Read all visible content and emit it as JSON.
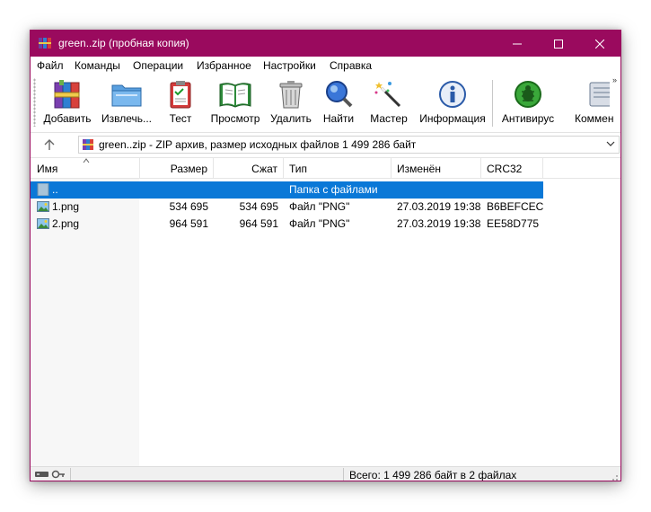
{
  "window": {
    "title": "green..zip (пробная копия)",
    "accent_color": "#9a0a5e"
  },
  "menu": [
    {
      "label": "Файл"
    },
    {
      "label": "Команды"
    },
    {
      "label": "Операции"
    },
    {
      "label": "Избранное"
    },
    {
      "label": "Настройки"
    },
    {
      "label": "Справка"
    }
  ],
  "toolbar": [
    {
      "label": "Добавить",
      "icon": "add-archive-icon"
    },
    {
      "label": "Извлечь...",
      "icon": "extract-folder-icon"
    },
    {
      "label": "Тест",
      "icon": "test-clipboard-icon"
    },
    {
      "label": "Просмотр",
      "icon": "view-book-icon"
    },
    {
      "label": "Удалить",
      "icon": "trash-icon"
    },
    {
      "label": "Найти",
      "icon": "magnifier-icon"
    },
    {
      "label": "Мастер",
      "icon": "wizard-wand-icon"
    },
    {
      "label": "Информация",
      "icon": "info-icon"
    },
    {
      "label": "Антивирус",
      "icon": "antivirus-bug-icon"
    },
    {
      "label": "Коммен",
      "icon": "comment-icon"
    }
  ],
  "address": {
    "path": "green..zip - ZIP архив, размер исходных файлов 1 499 286 байт"
  },
  "columns": [
    "Имя",
    "Размер",
    "Сжат",
    "Тип",
    "Изменён",
    "CRC32"
  ],
  "rows": [
    {
      "name": "..",
      "size": "",
      "packed": "",
      "type": "Папка с файлами",
      "modified": "",
      "crc": "",
      "selected": true
    },
    {
      "name": "1.png",
      "size": "534 695",
      "packed": "534 695",
      "type": "Файл \"PNG\"",
      "modified": "27.03.2019 19:38",
      "crc": "B6BEFCEC",
      "selected": false
    },
    {
      "name": "2.png",
      "size": "964 591",
      "packed": "964 591",
      "type": "Файл \"PNG\"",
      "modified": "27.03.2019 19:38",
      "crc": "EE58D775",
      "selected": false
    }
  ],
  "status": {
    "text": "Всего: 1 499 286 байт в 2 файлах"
  }
}
